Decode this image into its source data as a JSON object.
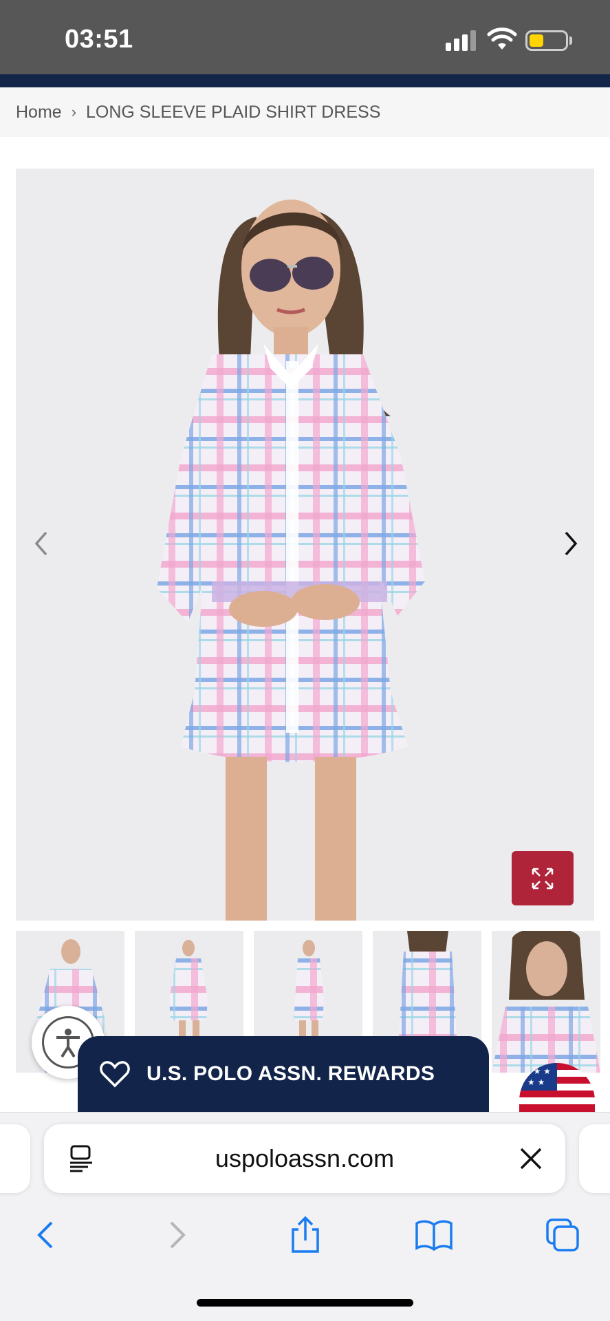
{
  "status_bar": {
    "time": "03:51",
    "battery_color": "#ffd400"
  },
  "breadcrumb": {
    "home": "Home",
    "separator": "›",
    "current": "LONG SLEEVE PLAID SHIRT DRESS"
  },
  "gallery": {
    "main_image_alt": "",
    "prev_icon": "chevron-left-icon",
    "next_icon": "chevron-right-icon",
    "expand_icon": "expand-icon",
    "expand_color": "#b0243a",
    "thumbnails": [
      "thumb-1",
      "thumb-2",
      "thumb-3",
      "thumb-4",
      "thumb-5"
    ]
  },
  "rewards": {
    "label": "U.S. POLO ASSN. REWARDS",
    "color": "#13244a"
  },
  "browser": {
    "url": "uspoloassn.com",
    "toolbar": [
      "back-icon",
      "forward-icon",
      "share-icon",
      "bookmarks-icon",
      "tabs-icon"
    ],
    "accent": "#1a7cf0"
  }
}
